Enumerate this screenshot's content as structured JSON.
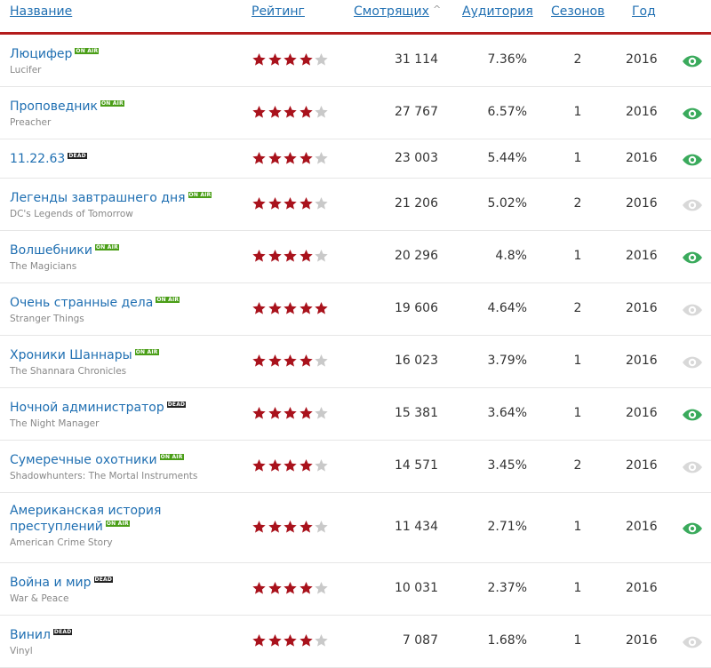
{
  "header": {
    "title": "Название",
    "rating": "Рейтинг",
    "viewers": "Смотрящих",
    "audience": "Аудитория",
    "seasons": "Сезонов",
    "year": "Год"
  },
  "badges": {
    "onair": "ON AIR",
    "dead": "DEAD"
  },
  "colors": {
    "link": "#1f6fb2",
    "accent_line": "#b31b1b",
    "star_on": "#a9121c",
    "star_off": "#c9c9c9",
    "eye_watching": "#3aaa5c",
    "eye_not": "#d8d8d8",
    "onair": "#4a9e17",
    "dead": "#222222"
  },
  "shows": [
    {
      "title": "Люцифер",
      "original": "Lucifer",
      "status": "onair",
      "stars": 4,
      "viewers": "31 114",
      "audience": "7.36%",
      "seasons": "2",
      "year": "2016",
      "watching": true
    },
    {
      "title": "Проповедник",
      "original": "Preacher",
      "status": "onair",
      "stars": 4,
      "viewers": "27 767",
      "audience": "6.57%",
      "seasons": "1",
      "year": "2016",
      "watching": true
    },
    {
      "title": "11.22.63",
      "original": "",
      "status": "dead",
      "stars": 4,
      "viewers": "23 003",
      "audience": "5.44%",
      "seasons": "1",
      "year": "2016",
      "watching": true
    },
    {
      "title": "Легенды завтрашнего дня",
      "original": "DC's Legends of Tomorrow",
      "status": "onair",
      "stars": 4,
      "viewers": "21 206",
      "audience": "5.02%",
      "seasons": "2",
      "year": "2016",
      "watching": false
    },
    {
      "title": "Волшебники",
      "original": "The Magicians",
      "status": "onair",
      "stars": 4,
      "viewers": "20 296",
      "audience": "4.8%",
      "seasons": "1",
      "year": "2016",
      "watching": true
    },
    {
      "title": "Очень странные дела",
      "original": "Stranger Things",
      "status": "onair",
      "stars": 5,
      "viewers": "19 606",
      "audience": "4.64%",
      "seasons": "2",
      "year": "2016",
      "watching": false
    },
    {
      "title": "Хроники Шаннары",
      "original": "The Shannara Chronicles",
      "status": "onair",
      "stars": 4,
      "viewers": "16 023",
      "audience": "3.79%",
      "seasons": "1",
      "year": "2016",
      "watching": false
    },
    {
      "title": "Ночной администратор",
      "original": "The Night Manager",
      "status": "dead",
      "stars": 4,
      "viewers": "15 381",
      "audience": "3.64%",
      "seasons": "1",
      "year": "2016",
      "watching": true
    },
    {
      "title": "Сумеречные охотники",
      "original": "Shadowhunters: The Mortal Instruments",
      "status": "onair",
      "stars": 4,
      "viewers": "14 571",
      "audience": "3.45%",
      "seasons": "2",
      "year": "2016",
      "watching": false
    },
    {
      "title": "Американская история преступлений",
      "title_line1": "Американская история",
      "title_line2": "преступлений",
      "original": "American Crime Story",
      "status": "onair",
      "stars": 4,
      "viewers": "11 434",
      "audience": "2.71%",
      "seasons": "1",
      "year": "2016",
      "watching": true
    },
    {
      "title": "Война и мир",
      "original": "War & Peace",
      "status": "dead",
      "stars": 4,
      "viewers": "10 031",
      "audience": "2.37%",
      "seasons": "1",
      "year": "2016",
      "watching": null
    },
    {
      "title": "Винил",
      "original": "Vinyl",
      "status": "dead",
      "stars": 4,
      "viewers": "7 087",
      "audience": "1.68%",
      "seasons": "1",
      "year": "2016",
      "watching": false
    }
  ]
}
